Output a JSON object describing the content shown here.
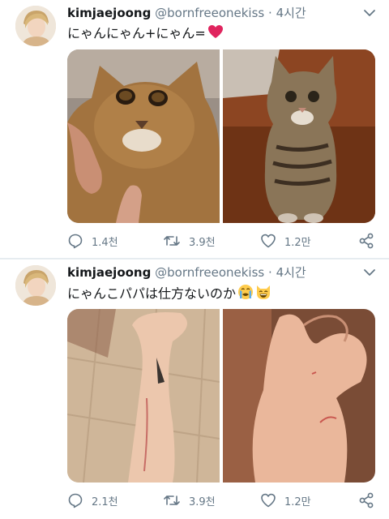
{
  "tweets": [
    {
      "display_name": "kimjaejoong",
      "handle": "@bornfreeonekiss",
      "separator": "·",
      "time": "4시간",
      "text": "にゃんにゃん+にゃん=",
      "text_emoji": "heart",
      "media": [
        "orange abyssinian cat held by hand",
        "tabby cat sitting on floor"
      ],
      "stats": {
        "replies": "1.4천",
        "retweets": "3.9천",
        "likes": "1.2만"
      }
    },
    {
      "display_name": "kimjaejoong",
      "handle": "@bornfreeonekiss",
      "separator": "·",
      "time": "4시간",
      "text": "にゃんこパパは仕方ないのか",
      "text_emoji": "crying-face, grinning-cat-face",
      "media": [
        "scratched forearm with tattoo",
        "scratched hand"
      ],
      "stats": {
        "replies": "2.1천",
        "retweets": "3.9천",
        "likes": "1.2만"
      }
    }
  ],
  "colors": {
    "name": "#14171a",
    "meta": "#657786",
    "heart": "#e0245e",
    "divider": "#e6ecf0"
  }
}
